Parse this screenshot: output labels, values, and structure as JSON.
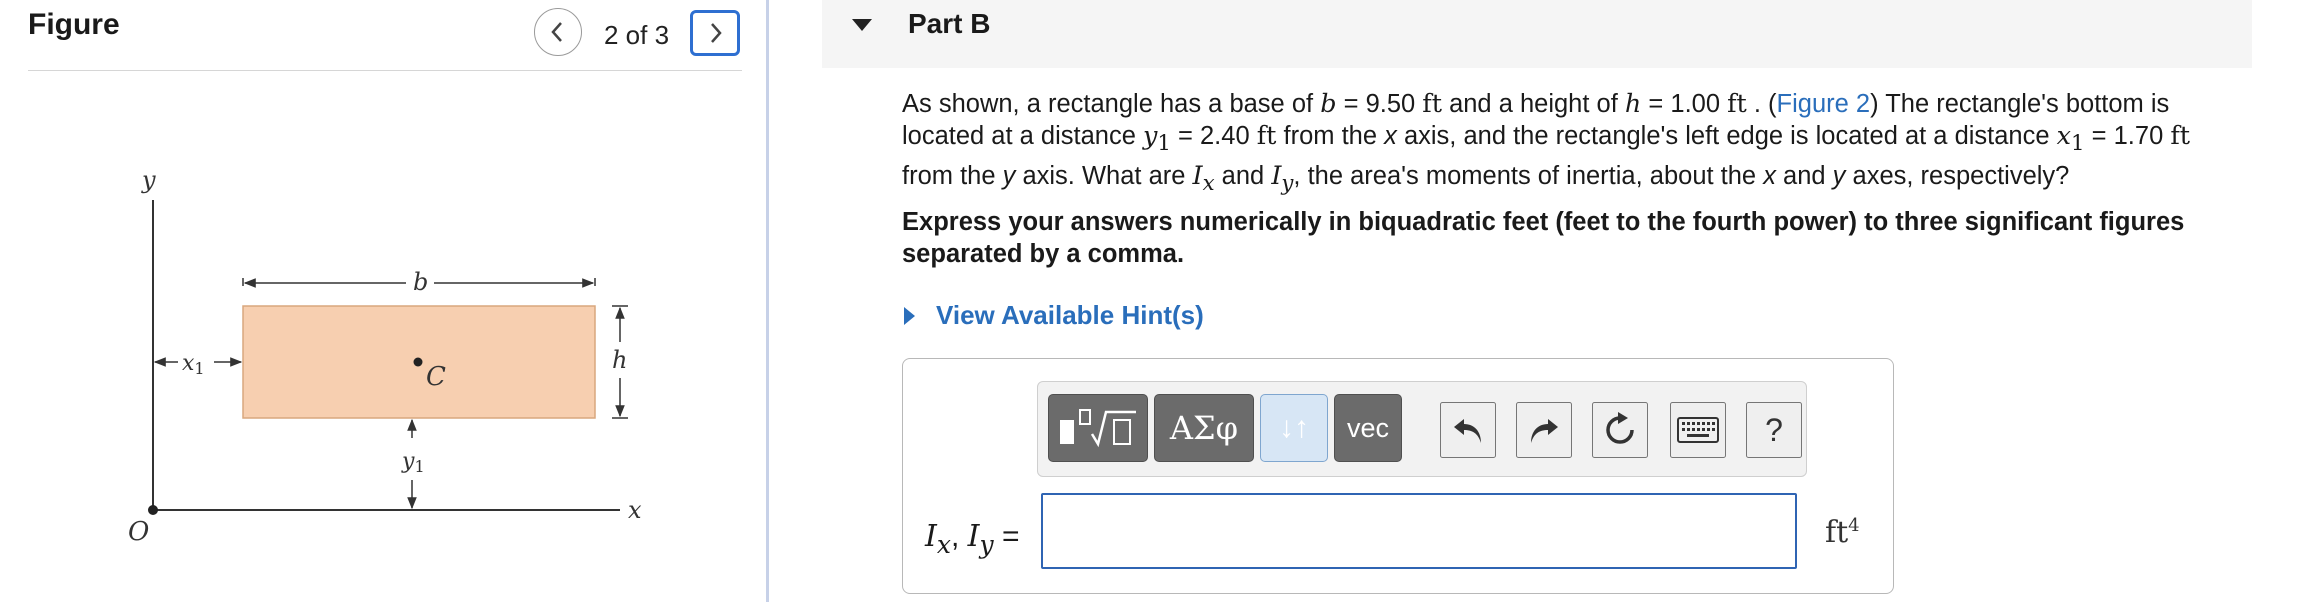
{
  "figure_panel": {
    "title": "Figure",
    "pagination": "2 of 3",
    "diagram_labels": {
      "y_axis": "y",
      "x_axis": "x",
      "origin": "O",
      "base": "b",
      "height": "h",
      "centroid": "C",
      "x1": "x1",
      "y1": "y1"
    },
    "rect_fill": "#f7cfb0"
  },
  "part": {
    "title": "Part B"
  },
  "question": {
    "s1": "As shown, a rectangle has a base of ",
    "b_sym": "b",
    "b_eq": " = 9.50 ",
    "ft": "ft",
    "s2": " and a height of ",
    "h_sym": "h",
    "h_eq": " = 1.00 ",
    "s3": " . (",
    "figure_link": "Figure 2",
    "s4": ") The rectangle's bottom is located at a distance ",
    "y_sym": "y",
    "sub1": "1",
    "y1_eq": " = 2.40 ",
    "s5": " from the ",
    "x_word": "x",
    "s6": " axis, and the rectangle's left edge is located at a distance ",
    "x_sym": "x",
    "x1_eq": " = 1.70 ",
    "s7": " from the ",
    "y_word": "y",
    "s8": " axis. What are ",
    "I_sym": "I",
    "sub_x": "x",
    "s9": " and ",
    "sub_y": "y",
    "s10": ", the area's moments of inertia, about the ",
    "s11": " and ",
    "s12": " axes, respectively?"
  },
  "instructions": "Express your answers numerically in biquadratic feet (feet to the fourth power) to three significant figures separated by a comma.",
  "hints": {
    "label": "View Available Hint(s)"
  },
  "answer": {
    "toolbar": {
      "greek_label": "ΑΣφ",
      "arrows_label": "↓↑",
      "vec_label": "vec",
      "help_label": "?"
    },
    "label_I": "I",
    "label_sub_x": "x",
    "label_sep": ", ",
    "label_sub_y": "y",
    "label_eq": " =",
    "input_value": "",
    "unit": "ft",
    "unit_exp": "4"
  },
  "colors": {
    "accent": "#2a6ebb",
    "input_border": "#2f64b3",
    "next_button_border": "#2e6fd1"
  }
}
